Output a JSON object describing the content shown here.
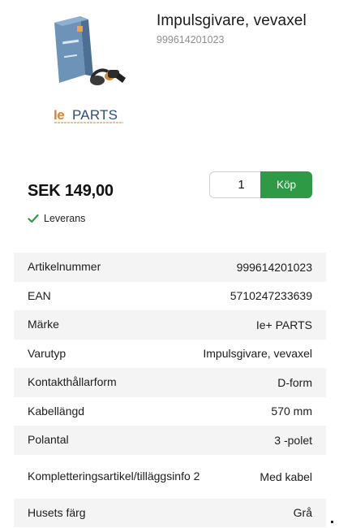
{
  "product": {
    "title": "Impulsgivare, vevaxel",
    "sku": "999614201023",
    "price": "SEK 149,00",
    "delivery": "Leverans",
    "quantity": "1",
    "buy_label": "Köp",
    "brand_logo": {
      "prefix": "Ie",
      "name": "PARTS"
    }
  },
  "specs": [
    {
      "label": "Artikelnummer",
      "value": "999614201023"
    },
    {
      "label": "EAN",
      "value": "5710247233639"
    },
    {
      "label": "Märke",
      "value": "Ie+ PARTS"
    },
    {
      "label": "Varutyp",
      "value": "Impulsgivare, vevaxel"
    },
    {
      "label": "Kontakthållarform",
      "value": "D-form"
    },
    {
      "label": "Kabellängd",
      "value": "570 mm"
    },
    {
      "label": "Polantal",
      "value": "3 -polet"
    },
    {
      "label": "Kompletteringsartikel/tilläggsinfo 2",
      "value": "Med kabel"
    },
    {
      "label": "Husets färg",
      "value": "Grå"
    }
  ],
  "colors": {
    "accent": "#2e9a46",
    "logo_orange": "#e8822a",
    "logo_blue": "#2d4d7c"
  }
}
